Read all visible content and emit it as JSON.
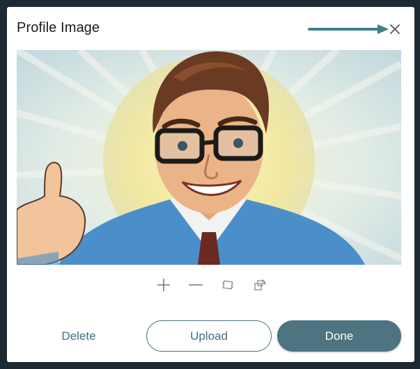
{
  "dialog": {
    "title": "Profile Image",
    "close_icon": "close-icon",
    "image": {
      "description_icon": "profile-portrait-image"
    },
    "tools": [
      {
        "icon": "zoom-in-icon"
      },
      {
        "icon": "zoom-out-icon"
      },
      {
        "icon": "crop-reset-icon"
      },
      {
        "icon": "rotate-icon"
      }
    ],
    "buttons": {
      "delete": "Delete",
      "upload": "Upload",
      "done": "Done"
    }
  },
  "colors": {
    "accent": "#4d7480",
    "accent_text": "#3f6f7c",
    "annotation_arrow": "#3e7f8c",
    "backdrop": "#1e2a33"
  }
}
